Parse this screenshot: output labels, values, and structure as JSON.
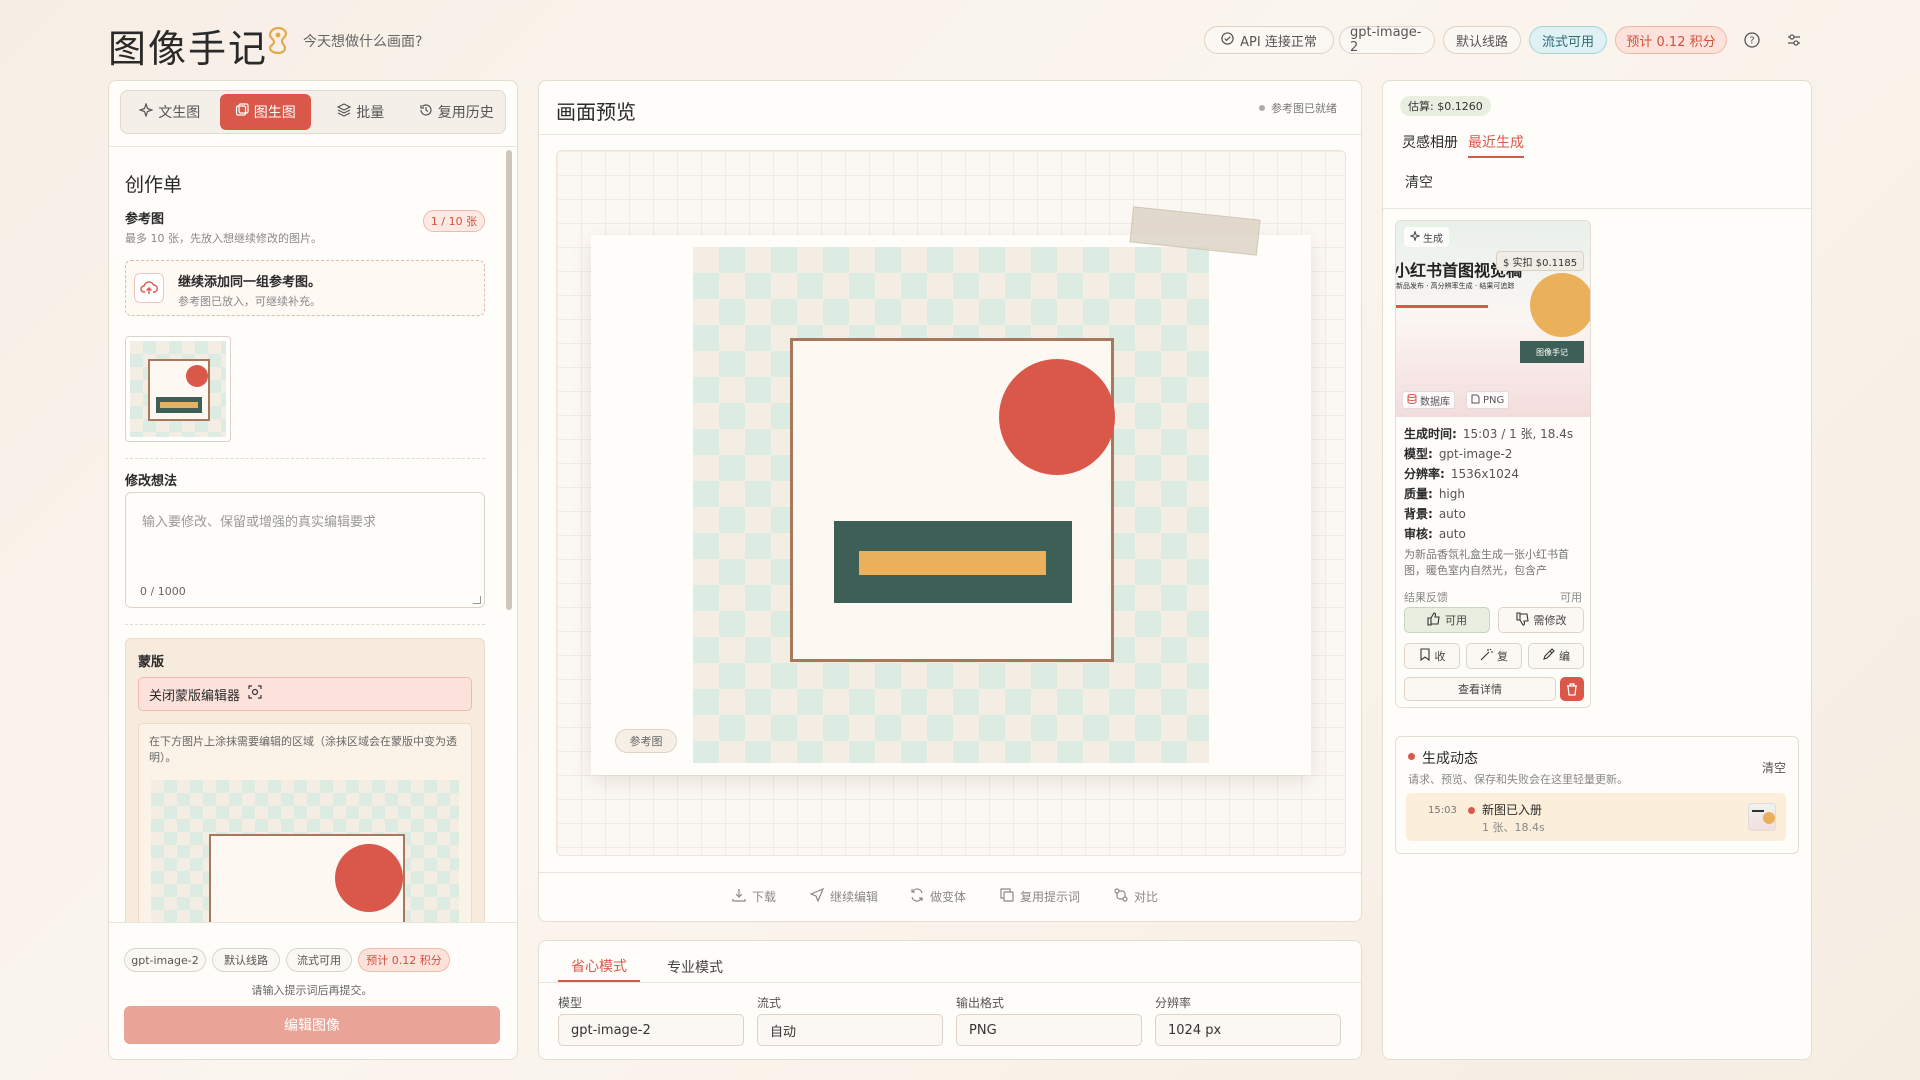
{
  "header": {
    "title": "图像手记",
    "tagline": "今天想做什么画面?",
    "api_status": "API 连接正常",
    "model": "gpt-image-2",
    "route": "默认线路",
    "stream": "流式可用",
    "estimate": "预计 0.12 积分"
  },
  "left": {
    "tabs": [
      {
        "label": "文生图",
        "icon": "sparkle-icon"
      },
      {
        "label": "图生图",
        "icon": "images-icon"
      },
      {
        "label": "批量",
        "icon": "layers-icon"
      },
      {
        "label": "复用历史",
        "icon": "history-icon"
      }
    ],
    "form_title": "创作单",
    "ref_label": "参考图",
    "ref_hint": "最多 10 张，先放入想继续修改的图片。",
    "ref_count": "1 / 10 张",
    "upload_title": "继续添加同一组参考图。",
    "upload_hint": "参考图已放入，可继续补充。",
    "idea_label": "修改想法",
    "idea_placeholder": "输入要修改、保留或增强的真实编辑要求",
    "idea_count": "0 / 1000",
    "mask_title": "蒙版",
    "mask_button": "关闭蒙版编辑器",
    "mask_hint": "在下方图片上涂抹需要编辑的区域（涂抹区域会在蒙版中变为透明）。",
    "chips": [
      "gpt-image-2",
      "默认线路",
      "流式可用",
      "预计 0.12 积分"
    ],
    "submit_hint": "请输入提示词后再提交。",
    "submit_label": "编辑图像"
  },
  "preview": {
    "title": "画面预览",
    "status": "参考图已就绪",
    "image_tag": "参考图",
    "toolbar": [
      "下载",
      "继续编辑",
      "做变体",
      "复用提示词",
      "对比"
    ]
  },
  "settings": {
    "modes": [
      "省心模式",
      "专业模式"
    ],
    "fields": [
      {
        "label": "模型",
        "value": "gpt-image-2"
      },
      {
        "label": "流式",
        "value": "自动"
      },
      {
        "label": "输出格式",
        "value": "PNG"
      },
      {
        "label": "分辨率",
        "value": "1024 px"
      }
    ]
  },
  "right": {
    "estimate": "估算: $0.1260",
    "tabs": [
      "灵感相册",
      "最近生成"
    ],
    "clear": "清空",
    "card": {
      "tag": "生成",
      "cost": "$ 实扣 $0.1185",
      "thumb_title": "小红书首图视觉稿",
      "thumb_sub": "新品发布 · 高分辨率生成 · 结果可追踪",
      "thumb_btn": "图像手记",
      "src_db": "数据库",
      "src_fmt": "PNG",
      "meta": [
        {
          "k": "生成时间:",
          "v": "15:03 / 1 张, 18.4s"
        },
        {
          "k": "模型:",
          "v": "gpt-image-2"
        },
        {
          "k": "分辨率:",
          "v": "1536x1024"
        },
        {
          "k": "质量:",
          "v": "high"
        },
        {
          "k": "背景:",
          "v": "auto"
        },
        {
          "k": "审核:",
          "v": "auto"
        }
      ],
      "desc": "为新品香氛礼盒生成一张小红书首图，暖色室内自然光，包含产",
      "feedback_label": "结果反馈",
      "feedback_value": "可用",
      "btn_ok": "可用",
      "btn_fix": "需修改",
      "btn_save": "收",
      "btn_redo": "复",
      "btn_edit": "编",
      "btn_detail": "查看详情"
    },
    "activity": {
      "title": "生成动态",
      "clear": "清空",
      "hint": "请求、预览、保存和失败会在这里轻量更新。",
      "time": "15:03",
      "item_title": "新图已入册",
      "item_sub": "1 张、18.4s"
    }
  },
  "colors": {
    "accent": "#d9584a",
    "green": "#3e5f55",
    "yellow": "#eab15a"
  }
}
